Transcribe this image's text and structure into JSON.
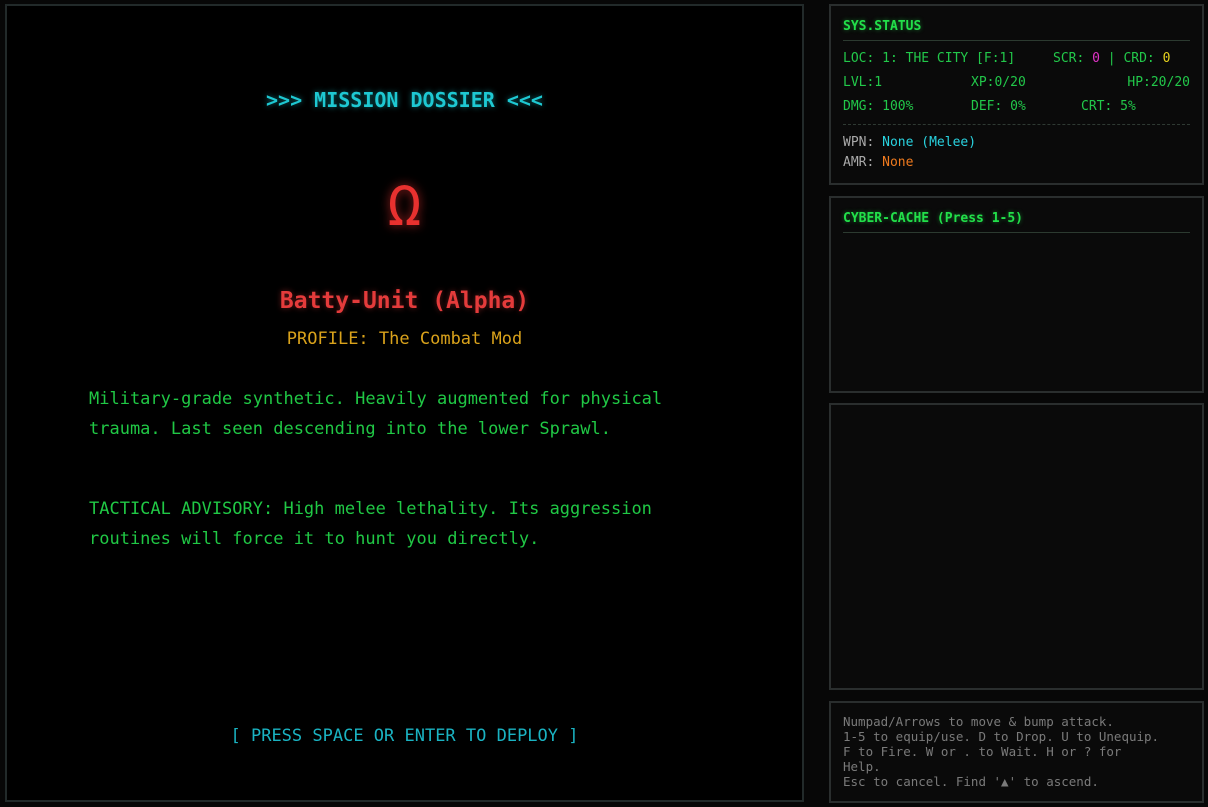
{
  "dossier": {
    "title": ">>> MISSION DOSSIER <<<",
    "glyph": "Ω",
    "unit_name": "Batty-Unit (Alpha)",
    "profile_label": "PROFILE:",
    "profile_value": "The Combat Mod",
    "description": "Military-grade synthetic. Heavily augmented for physical trauma. Last seen descending into the lower Sprawl.",
    "advisory": "TACTICAL ADVISORY: High melee lethality. Its aggression routines will force it to hunt you directly.",
    "deploy_prompt": "[ PRESS SPACE OR ENTER TO DEPLOY ]"
  },
  "status": {
    "header": "SYS.STATUS",
    "loc_label": "LOC:",
    "loc_value": "1: THE CITY [F:1]",
    "scr_label": "SCR:",
    "scr_value": "0",
    "separator": "|",
    "crd_label": "CRD:",
    "crd_value": "0",
    "lvl": "LVL:1",
    "xp": "XP:0/20",
    "hp": "HP:20/20",
    "dmg": "DMG: 100%",
    "def": "DEF: 0%",
    "crt": "CRT: 5%",
    "wpn_label": "WPN:",
    "wpn_value": "None (Melee)",
    "amr_label": "AMR:",
    "amr_value": "None"
  },
  "cache": {
    "header": "CYBER-CACHE (Press 1-5)"
  },
  "help": {
    "text": "Numpad/Arrows to move & bump attack.\n1-5 to equip/use. D to Drop. U to Unequip.\nF to Fire. W or . to Wait. H or ? for\nHelp.\nEsc to cancel. Find '▲' to ascend."
  },
  "colors": {
    "title_cyan": "#1ec8d2",
    "enemy_red": "#e8312f",
    "profile_gold": "#d9a21b",
    "terminal_green": "#20c845",
    "score_pink": "#e033c7",
    "credits_yellow": "#e6d21e",
    "weapon_cyan": "#29d3e0",
    "armor_orange": "#f07a1e"
  }
}
